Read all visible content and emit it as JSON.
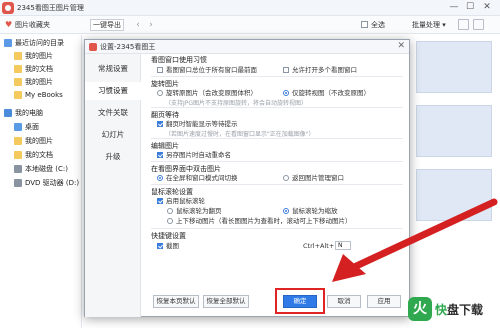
{
  "app": {
    "title": "2345看图王图片管理"
  },
  "window_controls": {
    "minimize": "—",
    "maximize": "☐",
    "close": "✕"
  },
  "toolbar": {
    "favorites": "图片收藏夹",
    "export": "一键导出",
    "select_all": "全选",
    "batch": "批量处理 ▾",
    "nav_back": "‹",
    "nav_forward": "›"
  },
  "sidebar": {
    "recent_header": "最近访问的目录",
    "recent_items": [
      "我的图片",
      "我的文档",
      "我的图片",
      "My eBooks"
    ],
    "pc_header": "我的电脑",
    "pc_items": [
      "桌面",
      "我的图片",
      "我的文档",
      "本地磁盘 (C:)",
      "DVD 驱动器 (D:)"
    ]
  },
  "dialog": {
    "title": "设置-2345看图王",
    "close": "✕",
    "nav": [
      "常规设置",
      "习惯设置",
      "文件关联",
      "幻灯片",
      "升级"
    ],
    "active_nav_index": 1,
    "sections": {
      "window_habit": {
        "title": "看图窗口使用习惯",
        "opt1": "看图窗口总位于所有窗口最前面",
        "opt2": "允许打开多个看图窗口"
      },
      "rotate": {
        "title": "旋转图片",
        "opt1": "旋转原图片（会改变原图体积）",
        "opt1_hint": "（支持JPG图片不支持原图旋转，将会自动旋转视图）",
        "opt2": "仅旋转视图（不改变原图）"
      },
      "page_wait": {
        "title": "翻页等待",
        "opt1": "翻页时智能显示等待提示",
        "hint": "（若图片速度过慢时，在看图窗口显示\"正在加载图像\"）"
      },
      "edit": {
        "title": "编辑图片",
        "opt1": "另存图片时自动重命名"
      },
      "dblclick": {
        "title": "在看图界面中双击图片",
        "opt1": "在全屏和窗口模式间切换",
        "opt2": "返回图片管理窗口"
      },
      "wheel": {
        "title": "鼠标滚轮设置",
        "enable": "启用鼠标滚轮",
        "opt1": "鼠标滚轮为翻页",
        "opt2": "鼠标滚轮为缩放",
        "opt3": "上下移动图片（看长图图片为查看时，滚动可上下移动图片）"
      },
      "hotkey": {
        "title": "快捷键设置",
        "opt1": "截图",
        "combo": "Ctrl+Alt+",
        "key": "N"
      }
    },
    "buttons": {
      "restore_page": "恢复本页默认",
      "restore_all": "恢复全部默认",
      "ok": "确定",
      "cancel": "取消",
      "apply": "应用"
    }
  },
  "watermark": {
    "badge": "火",
    "text_accent": "快",
    "text_rest": "盘下载"
  },
  "colors": {
    "accent": "#2f7ae6",
    "highlight": "#e02424",
    "arrow": "#d42020",
    "watermark_green": "#2fa84f"
  }
}
